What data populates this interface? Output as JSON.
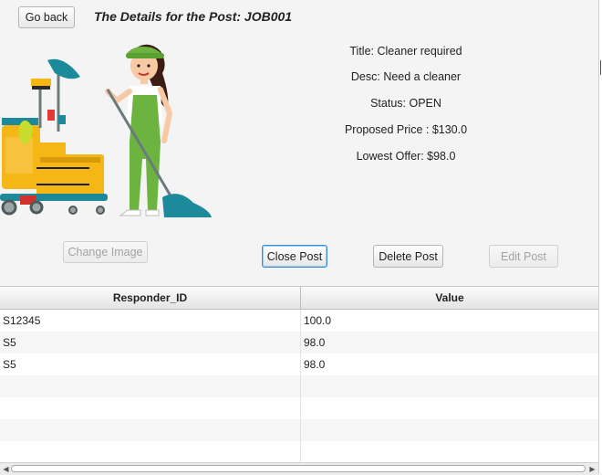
{
  "header": {
    "back_label": "Go back",
    "title": "The Details for the Post: JOB001"
  },
  "post": {
    "title": "Title: Cleaner required",
    "desc": "Desc: Need a cleaner",
    "status": "Status: OPEN",
    "proposed_price": "Proposed Price : $130.0",
    "lowest_offer": "Lowest Offer: $98.0"
  },
  "actions": {
    "change_image": "Change Image",
    "close_post": "Close Post",
    "delete_post": "Delete Post",
    "edit_post": "Edit Post"
  },
  "table": {
    "columns": [
      "Responder_ID",
      "Value"
    ],
    "rows": [
      [
        "S12345",
        "100.0"
      ],
      [
        "S5",
        "98.0"
      ],
      [
        "S5",
        "98.0"
      ],
      [
        "",
        ""
      ],
      [
        "",
        ""
      ],
      [
        "",
        ""
      ],
      [
        "",
        ""
      ]
    ]
  },
  "colors": {
    "background": "#f4f4f4",
    "focus_border": "#3a8fd8",
    "cleaner_uniform": "#6cb33f",
    "cart_yellow": "#f5b716",
    "mop_teal": "#1c8a9a"
  },
  "icons": {
    "illustration": "cleaning-lady-illustration",
    "scroll_left": "chevron-left-icon",
    "scroll_right": "chevron-right-icon"
  }
}
